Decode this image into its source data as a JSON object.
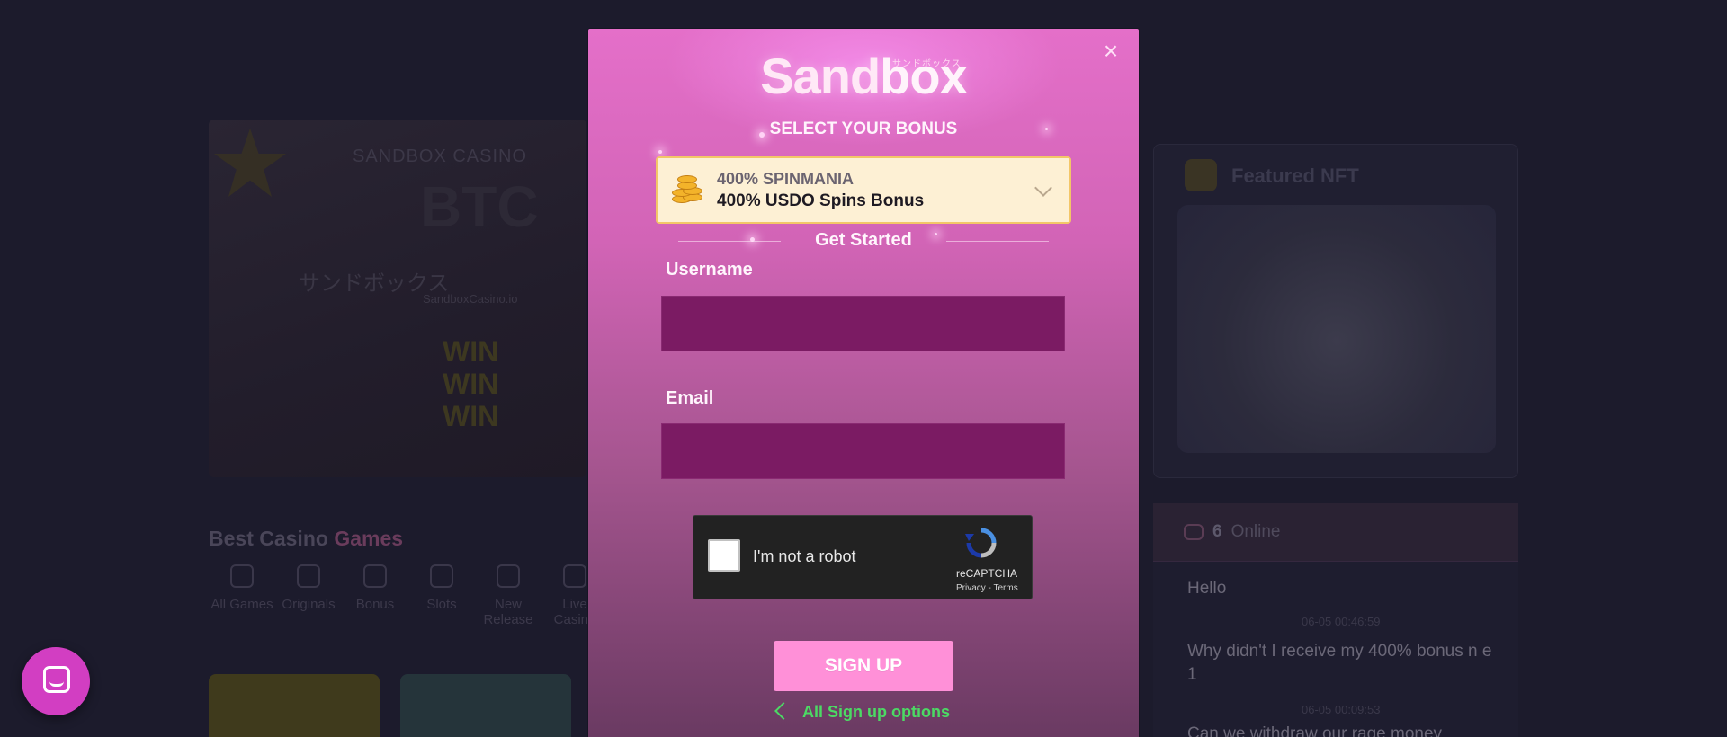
{
  "background": {
    "banner": {
      "top_text": "SANDBOX CASINO",
      "jp_text": "サンドボックス",
      "url_text": "SandboxCasino.io",
      "win_lines": [
        "WIN",
        "WIN",
        "WIN"
      ]
    },
    "section_title_main": "Best Casino ",
    "section_title_accent": "Games",
    "categories": [
      {
        "label": "All Games",
        "icon": "grid-icon"
      },
      {
        "label": "Originals",
        "icon": "originals-icon"
      },
      {
        "label": "Bonus",
        "icon": "money-bag-icon"
      },
      {
        "label": "Slots",
        "icon": "slots-icon"
      },
      {
        "label": "New Release",
        "icon": "flame-icon"
      },
      {
        "label": "Live Casino",
        "icon": "live-icon"
      }
    ],
    "featured_title": "Featured NFT",
    "chat": {
      "online_count": "6",
      "online_label": "Online",
      "messages": [
        {
          "text": "Hello"
        },
        {
          "time": "06-05 00:46:59"
        },
        {
          "text": "Why didn't I receive my 400% bonus n e 1"
        },
        {
          "time": "06-05 00:09:53"
        },
        {
          "text": "Can we withdraw our rage money"
        }
      ]
    }
  },
  "modal": {
    "logo_text_a": "Sand",
    "logo_text_b": "box",
    "logo_jp": "サンドボックス",
    "close_icon": "close-icon",
    "select_title": "SELECT YOUR BONUS",
    "bonus": {
      "name": "400% SPINMANIA",
      "description": "400% USDO Spins Bonus",
      "icon": "coins-icon",
      "colors": {
        "bg": "#fdf0d4",
        "border": "#f3c668"
      }
    },
    "get_started": "Get Started",
    "username_label": "Username",
    "username_value": "",
    "email_label": "Email",
    "email_value": "",
    "captcha": {
      "label": "I'm not a robot",
      "brand": "reCAPTCHA",
      "links": "Privacy - Terms"
    },
    "signup_label": "SIGN UP",
    "all_options_label": "All Sign up options",
    "colors": {
      "accent": "#ff90d8",
      "link": "#4cd964",
      "input_bg": "#7b1b63"
    }
  },
  "launcher": {
    "icon": "chat-icon",
    "color": "#d23ec2"
  }
}
